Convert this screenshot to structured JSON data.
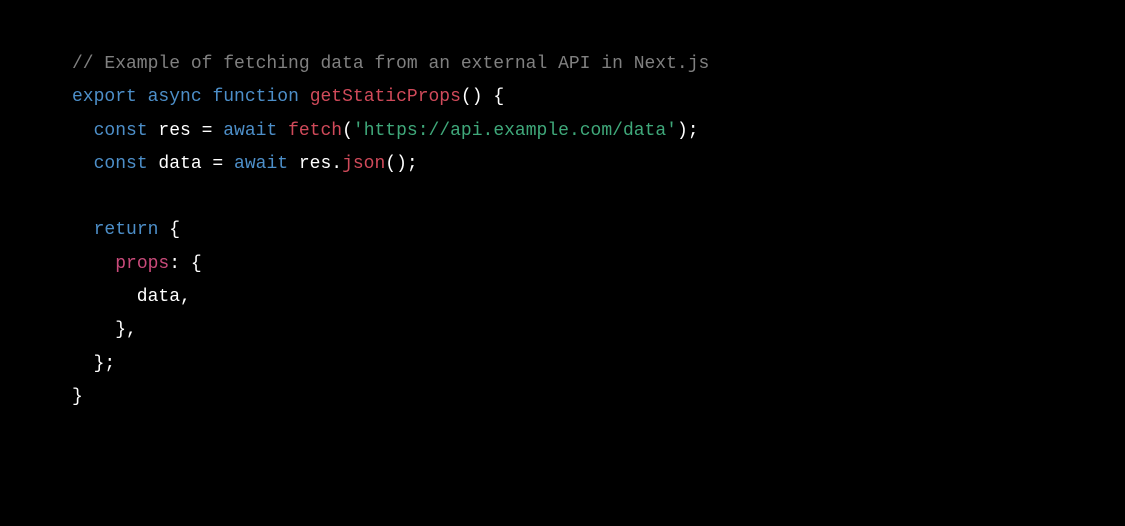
{
  "code": {
    "line1_comment": "// Example of fetching data from an external API in Next.js",
    "line2_export": "export",
    "line2_async": "async",
    "line2_function": "function",
    "line2_fnname": "getStaticProps",
    "line2_tail": "() {",
    "line3_indent": "  ",
    "line3_const": "const",
    "line3_res": " res = ",
    "line3_await": "await",
    "line3_sp": " ",
    "line3_fetch": "fetch",
    "line3_open": "(",
    "line3_str": "'https://api.example.com/data'",
    "line3_close": ");",
    "line4_indent": "  ",
    "line4_const": "const",
    "line4_data": " data = ",
    "line4_await": "await",
    "line4_resdot": " res.",
    "line4_json": "json",
    "line4_tail": "();",
    "line6_indent": "  ",
    "line6_return": "return",
    "line6_brace": " {",
    "line7_indent": "    ",
    "line7_props": "props",
    "line7_tail": ": {",
    "line8": "      data,",
    "line9": "    },",
    "line10": "  };",
    "line11": "}"
  }
}
